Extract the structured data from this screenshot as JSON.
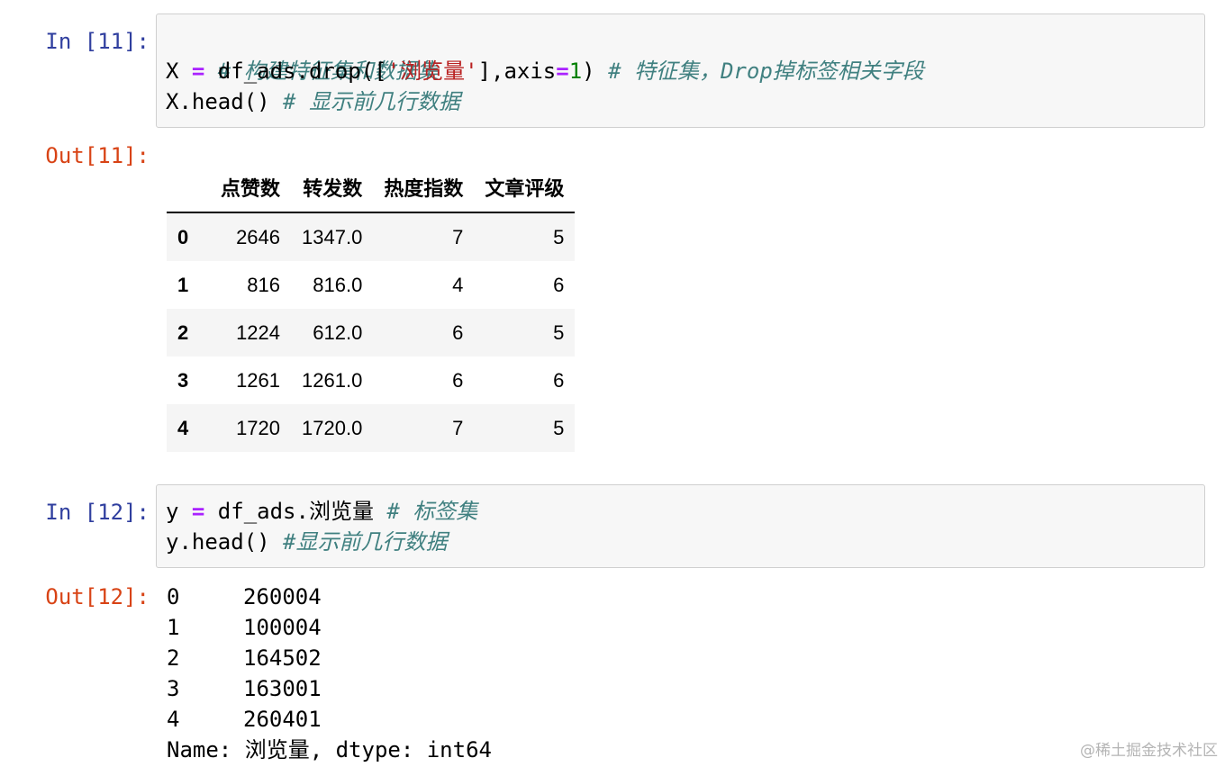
{
  "cell_11": {
    "in_prompt": "In [11]:",
    "out_prompt": "Out[11]:",
    "code": {
      "line1_comment": "# 构建特征集和数据集",
      "line2_var": "X ",
      "line2_op": "=",
      "line2_call": " df_ads.drop([",
      "line2_str": "'浏览量'",
      "line2_mid": "],axis",
      "line2_eq": "=",
      "line2_num": "1",
      "line2_close": ") ",
      "line2_comment": "# 特征集，Drop掉标签相关字段",
      "line3_code": "X.head() ",
      "line3_comment": "# 显示前几行数据"
    },
    "table": {
      "columns": [
        "点赞数",
        "转发数",
        "热度指数",
        "文章评级"
      ],
      "rows": [
        {
          "index": "0",
          "cells": [
            "2646",
            "1347.0",
            "7",
            "5"
          ]
        },
        {
          "index": "1",
          "cells": [
            "816",
            "816.0",
            "4",
            "6"
          ]
        },
        {
          "index": "2",
          "cells": [
            "1224",
            "612.0",
            "6",
            "5"
          ]
        },
        {
          "index": "3",
          "cells": [
            "1261",
            "1261.0",
            "6",
            "6"
          ]
        },
        {
          "index": "4",
          "cells": [
            "1720",
            "1720.0",
            "7",
            "5"
          ]
        }
      ]
    }
  },
  "cell_12": {
    "in_prompt": "In [12]:",
    "out_prompt": "Out[12]:",
    "code": {
      "line1_var": "y ",
      "line1_op": "=",
      "line1_rest": " df_ads.浏览量 ",
      "line1_comment": "# 标签集",
      "line2_code": "y.head() ",
      "line2_comment": "#显示前几行数据"
    },
    "series": {
      "rows": [
        {
          "index": "0",
          "value": "260004"
        },
        {
          "index": "1",
          "value": "100004"
        },
        {
          "index": "2",
          "value": "164502"
        },
        {
          "index": "3",
          "value": "163001"
        },
        {
          "index": "4",
          "value": "260401"
        }
      ],
      "meta": "Name: 浏览量, dtype: int64"
    }
  },
  "watermark": "@稀土掘金技术社区"
}
